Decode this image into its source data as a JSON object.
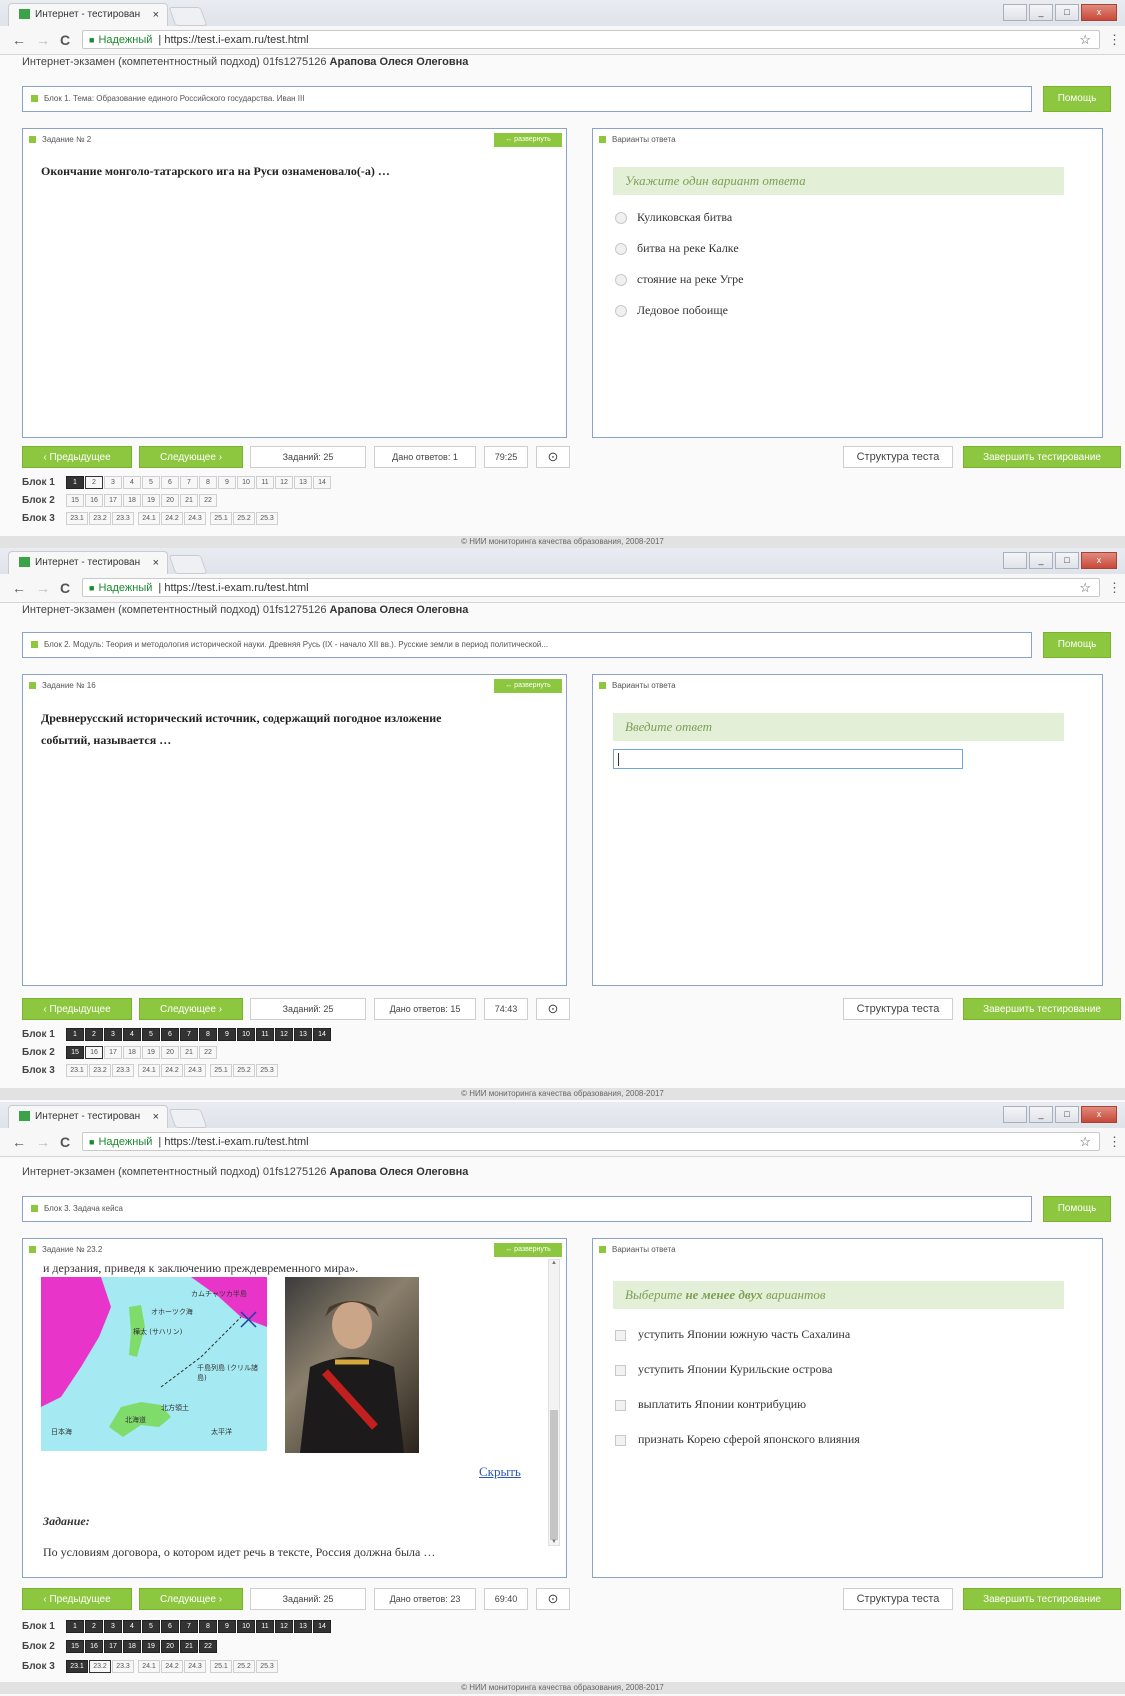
{
  "browser": {
    "tab_title": "Интернет - тестирован",
    "secure_label": "Надежный",
    "url": "https://test.i-exam.ru/test.html",
    "tab_close": "×",
    "star": "☆",
    "menu": "⋮",
    "back": "←",
    "forward": "→",
    "reload": "C",
    "lock": "🔒"
  },
  "user_line": {
    "prefix": "Интернет-экзамен (компетентностный подход) 01fs1275126",
    "name": "Арапова Олеся Олеговна"
  },
  "common": {
    "help_label": "Помощь",
    "expand_label": "↔ развернуть",
    "answers_title": "Варианты ответа",
    "prev_label": "‹ Предыдущее",
    "next_label": "Следующее ›",
    "tasks_label": "Заданий: 25",
    "structure_label": "Структура теста",
    "finish_label": "Завершить тестирование",
    "timer_icon": "⊙",
    "footer": "© НИИ мониторинга качества образования, 2008-2017",
    "block1_label": "Блок 1",
    "block2_label": "Блок 2",
    "block3_label": "Блок 3",
    "block1_cells": [
      "1",
      "2",
      "3",
      "4",
      "5",
      "6",
      "7",
      "8",
      "9",
      "10",
      "11",
      "12",
      "13",
      "14"
    ],
    "block2_cells": [
      "15",
      "16",
      "17",
      "18",
      "19",
      "20",
      "21",
      "22"
    ],
    "block3_cells": [
      "23.1",
      "23.2",
      "23.3",
      "24.1",
      "24.2",
      "24.3",
      "25.1",
      "25.2",
      "25.3"
    ]
  },
  "screen1": {
    "block_bar": "Блок 1. Тема: Образование единого Российского государства. Иван III",
    "task_title": "Задание № 2",
    "question": "Окончание монголо-татарского ига на Руси ознаменовало(-а) …",
    "hint": "Укажите один вариант ответа",
    "options": [
      "Куликовская битва",
      "битва на реке Калке",
      "стояние на реке Угре",
      "Ледовое побоище"
    ],
    "answered": "Дано ответов: 1",
    "timer": "79:25"
  },
  "screen2": {
    "block_bar": "Блок 2. Модуль: Теория и методология исторической науки. Древняя Русь (IX - начало XII вв.). Русские земли в период политической...",
    "task_title": "Задание № 16",
    "question": "Древнерусский исторический источник, содержащий погодное изложение событий, называется …",
    "hint": "Введите ответ",
    "answered": "Дано ответов: 15",
    "timer": "74:43"
  },
  "screen3": {
    "block_bar": "Блок 3. Задача кейса",
    "task_title": "Задание № 23.2",
    "case_text": "и дерзания, приведя к заключению преждевременного мира».",
    "hide_link": "Скрыть",
    "zadanie_label": "Задание:",
    "zadanie_text": "По условиям договора, о котором идет речь в тексте, Россия должна была …",
    "hint_plain": "Выберите ",
    "hint_bold": "не менее двух",
    "hint_tail": " вариантов",
    "options": [
      "уступить Японии южную часть Сахалина",
      "уступить Японии Курильские острова",
      "выплатить Японии контрибуцию",
      "признать Корею сферой японского влияния"
    ],
    "answered": "Дано ответов: 23",
    "timer": "69:40",
    "map_labels": [
      "カムチャツカ半島",
      "樺太\n(サハリン)",
      "千島列島\n(クリル諸島)",
      "北方領土",
      "太平洋",
      "オホーツク海",
      "日本海",
      "北海道"
    ]
  },
  "colors": {
    "accent_green": "#8dc63f",
    "panel_border": "#8aa3c8",
    "hint_bg": "#e4efd8",
    "done_cell": "#333333"
  }
}
